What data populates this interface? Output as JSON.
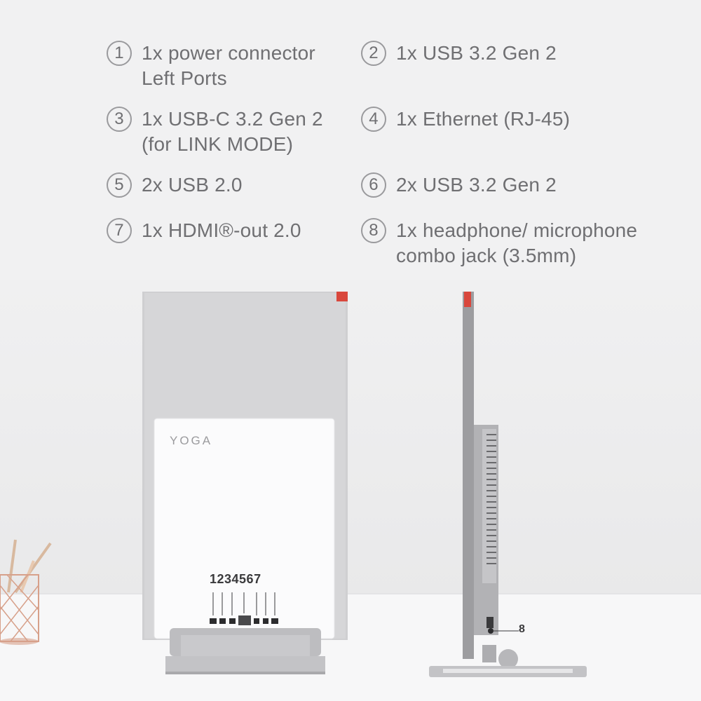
{
  "specs": [
    {
      "num": "1",
      "lines": [
        "1x power connector",
        "Left Ports"
      ]
    },
    {
      "num": "2",
      "lines": [
        "1x USB 3.2 Gen 2"
      ]
    },
    {
      "num": "3",
      "lines": [
        "1x USB-C 3.2 Gen 2",
        "(for LINK MODE)"
      ]
    },
    {
      "num": "4",
      "lines": [
        "1x Ethernet (RJ-45)"
      ]
    },
    {
      "num": "5",
      "lines": [
        "2x USB 2.0"
      ]
    },
    {
      "num": "6",
      "lines": [
        "2x USB 3.2 Gen 2"
      ]
    },
    {
      "num": "7",
      "lines": [
        "1x HDMI®-out 2.0"
      ]
    },
    {
      "num": "8",
      "lines": [
        "1x headphone/ microphone",
        "combo jack (3.5mm)"
      ]
    }
  ],
  "product": {
    "logo": "YOGA",
    "port_numbers": "1234567",
    "side_port_label": "8"
  },
  "colors": {
    "background": "#f1f1f2",
    "text": "#6f6f72",
    "accent_red": "#d9473c",
    "aluminum": "#c9c9cb",
    "white_panel": "#fbfbfc",
    "rose_gold": "#d7a08a"
  }
}
